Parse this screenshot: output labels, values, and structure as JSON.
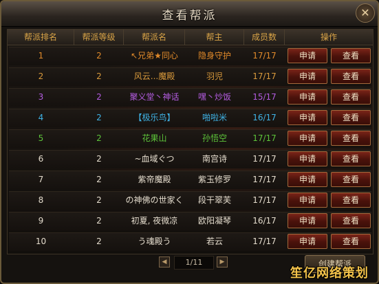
{
  "window": {
    "title": "查看帮派"
  },
  "table": {
    "columns": [
      "帮派排名",
      "帮派等级",
      "帮派名",
      "帮主",
      "成员数",
      "操作"
    ],
    "rows": [
      {
        "rank": "1",
        "level": "2",
        "name": "↖兄弟★同心",
        "leader": "隐身守护",
        "members": "17/17",
        "color": "#e08a2a"
      },
      {
        "rank": "2",
        "level": "2",
        "name": "风云...魔殿",
        "leader": "羽児",
        "members": "17/17",
        "color": "#d99a3c"
      },
      {
        "rank": "3",
        "level": "2",
        "name": "聚义堂丶神话",
        "leader": "嘿丶炒饭",
        "members": "15/17",
        "color": "#b35ce0"
      },
      {
        "rank": "4",
        "level": "2",
        "name": "【极乐鸟】",
        "leader": "啪啦米",
        "members": "16/17",
        "color": "#3fb3e6"
      },
      {
        "rank": "5",
        "level": "2",
        "name": "花果山",
        "leader": "孙悟空",
        "members": "17/17",
        "color": "#5dc43a"
      },
      {
        "rank": "6",
        "level": "2",
        "name": "~血域ぐつ",
        "leader": "南宫诗",
        "members": "17/17",
        "color": "#e4dccd"
      },
      {
        "rank": "7",
        "level": "2",
        "name": "紫帝魔殿",
        "leader": "紫玉修罗",
        "members": "17/17",
        "color": "#e4dccd"
      },
      {
        "rank": "8",
        "level": "2",
        "name": "の神佛の世家く",
        "leader": "段干翠芙",
        "members": "17/17",
        "color": "#e4dccd"
      },
      {
        "rank": "9",
        "level": "2",
        "name": "初夏, 夜微凉",
        "leader": "欧阳凝琴",
        "members": "16/17",
        "color": "#e4dccd"
      },
      {
        "rank": "10",
        "level": "2",
        "name": "う魂殿う",
        "leader": "若云",
        "members": "17/17",
        "color": "#e4dccd"
      }
    ],
    "actions": {
      "apply": "申请",
      "view": "查看"
    }
  },
  "pager": {
    "text": "1/11",
    "prev": "◀",
    "next": "▶"
  },
  "create_button": "创建帮派",
  "watermark": "笙亿网络策划",
  "colors": {
    "header_text": "#d8a347",
    "button_red": "#6a1a10",
    "border": "#6b5a3a"
  }
}
